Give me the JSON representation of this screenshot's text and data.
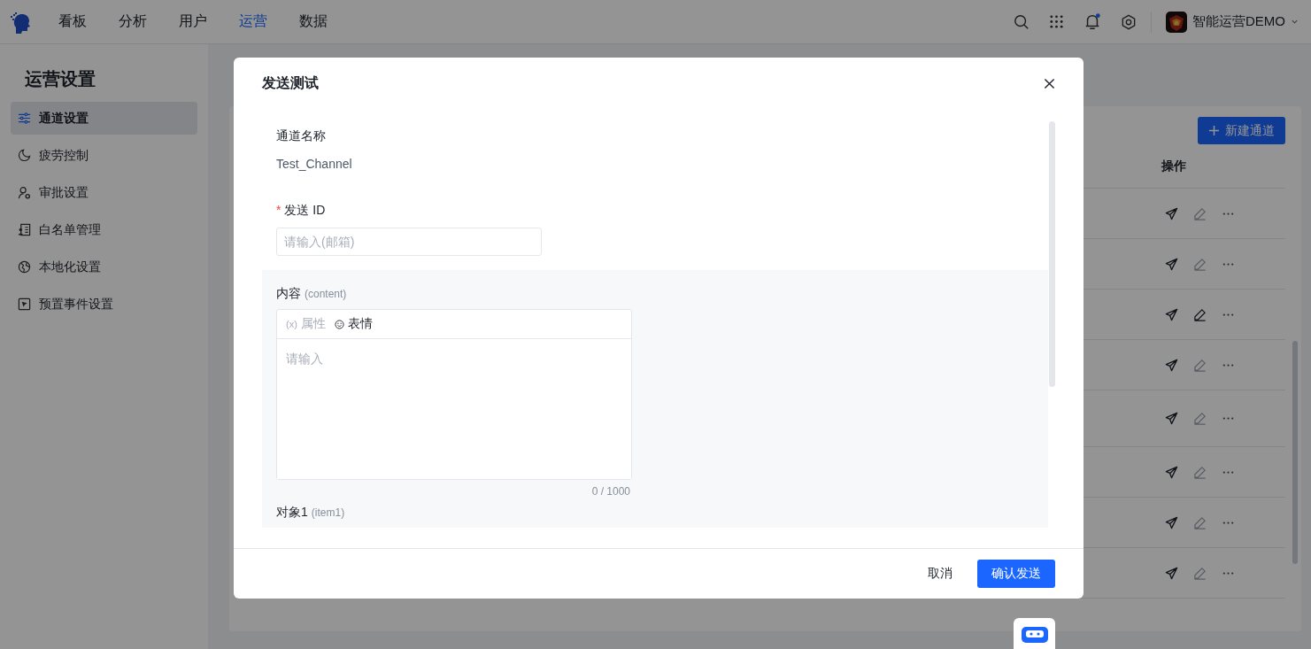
{
  "topnav": {
    "items": [
      {
        "label": "看板",
        "selected": false
      },
      {
        "label": "分析",
        "selected": false
      },
      {
        "label": "用户",
        "selected": false
      },
      {
        "label": "运营",
        "selected": true
      },
      {
        "label": "数据",
        "selected": false
      }
    ],
    "notification_unread": true,
    "account": "智能运营DEMO"
  },
  "sidebar": {
    "title": "运营设置",
    "items": [
      {
        "label": "通道设置",
        "selected": true
      },
      {
        "label": "疲劳控制",
        "selected": false
      },
      {
        "label": "审批设置",
        "selected": false
      },
      {
        "label": "白名单管理",
        "selected": false
      },
      {
        "label": "本地化设置",
        "selected": false
      },
      {
        "label": "预置事件设置",
        "selected": false
      }
    ]
  },
  "table": {
    "new_button": "新建通道",
    "action_column": "操作",
    "rows": [
      {
        "edit_enabled": false
      },
      {
        "edit_enabled": false
      },
      {
        "edit_enabled": true
      },
      {
        "edit_enabled": false
      },
      {
        "edit_enabled": false
      },
      {
        "edit_enabled": false
      },
      {
        "edit_enabled": false
      },
      {
        "edit_enabled": false
      }
    ]
  },
  "dialog": {
    "title": "发送测试",
    "channel_label": "通道名称",
    "channel_value": "Test_Channel",
    "id_label": "发送 ID",
    "required_mark": "*",
    "id_placeholder": "请输入(邮箱)",
    "content_label": "内容",
    "content_hint": "(content)",
    "toolbar": [
      {
        "kind": "variable",
        "symbol": "(x)",
        "label": "属性",
        "disabled": true
      },
      {
        "kind": "emoji",
        "label": "表情",
        "disabled": false
      }
    ],
    "content_placeholder": "请输入",
    "counter": "0 / 1000",
    "item_label": "对象1",
    "item_hint": "(item1)",
    "cancel": "取消",
    "confirm": "确认发送"
  }
}
